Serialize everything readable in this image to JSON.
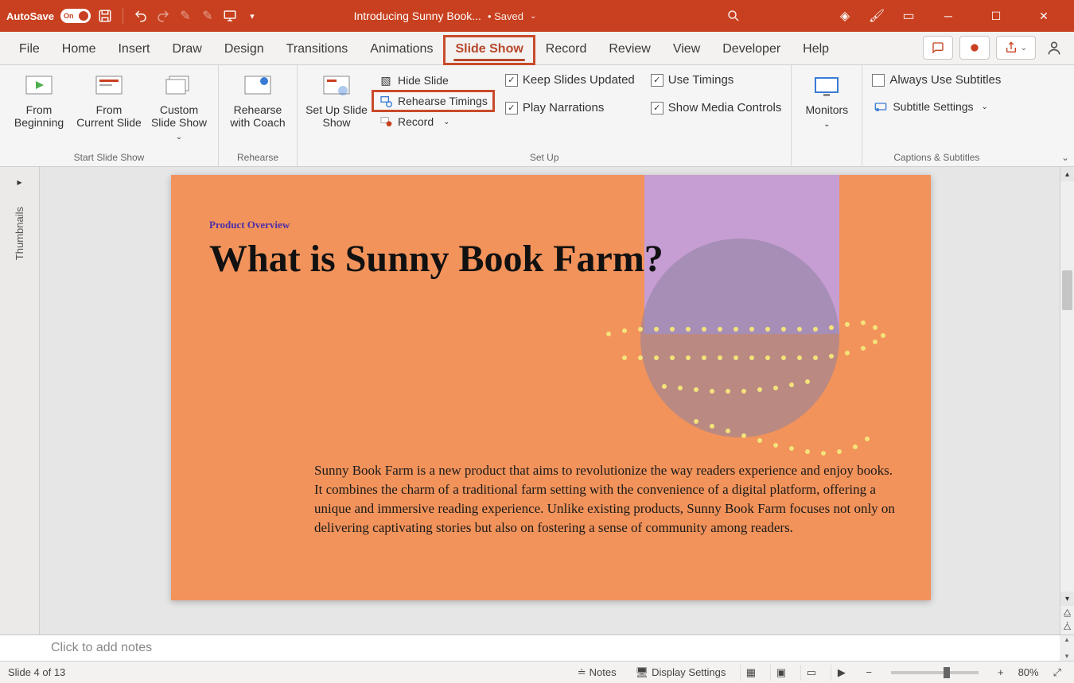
{
  "titlebar": {
    "autosave_label": "AutoSave",
    "autosave_state": "On",
    "doc_title": "Introducing Sunny Book...",
    "saved_status": "• Saved"
  },
  "tabs": {
    "file": "File",
    "home": "Home",
    "insert": "Insert",
    "draw": "Draw",
    "design": "Design",
    "transitions": "Transitions",
    "animations": "Animations",
    "slideshow": "Slide Show",
    "record": "Record",
    "review": "Review",
    "view": "View",
    "developer": "Developer",
    "help": "Help"
  },
  "ribbon": {
    "groups": {
      "start": "Start Slide Show",
      "rehearse": "Rehearse",
      "setup": "Set Up",
      "captions": "Captions & Subtitles"
    },
    "from_beginning": "From Beginning",
    "from_current": "From Current Slide",
    "custom_show": "Custom Slide Show",
    "rehearse_coach": "Rehearse with Coach",
    "setup_slideshow": "Set Up Slide Show",
    "hide_slide": "Hide Slide",
    "rehearse_timings": "Rehearse Timings",
    "record_cmd": "Record",
    "keep_updated": "Keep Slides Updated",
    "play_narrations": "Play Narrations",
    "use_timings": "Use Timings",
    "show_media": "Show Media Controls",
    "monitors": "Monitors",
    "always_subtitles": "Always Use Subtitles",
    "subtitle_settings": "Subtitle Settings"
  },
  "thumbnails_label": "Thumbnails",
  "slide": {
    "overline": "Product Overview",
    "headline": "What is Sunny Book Farm?",
    "body": "Sunny Book Farm is a new product that aims to revolutionize the way readers experience and enjoy books. It combines the charm of a traditional farm setting with the convenience of a digital platform, offering a unique and immersive reading experience. Unlike existing products, Sunny Book Farm focuses not only on delivering captivating stories but also on fostering a sense of community among readers."
  },
  "notes_placeholder": "Click to add notes",
  "statusbar": {
    "slide_counter": "Slide 4 of 13",
    "notes_btn": "Notes",
    "display_settings": "Display Settings",
    "zoom_pct": "80%"
  }
}
